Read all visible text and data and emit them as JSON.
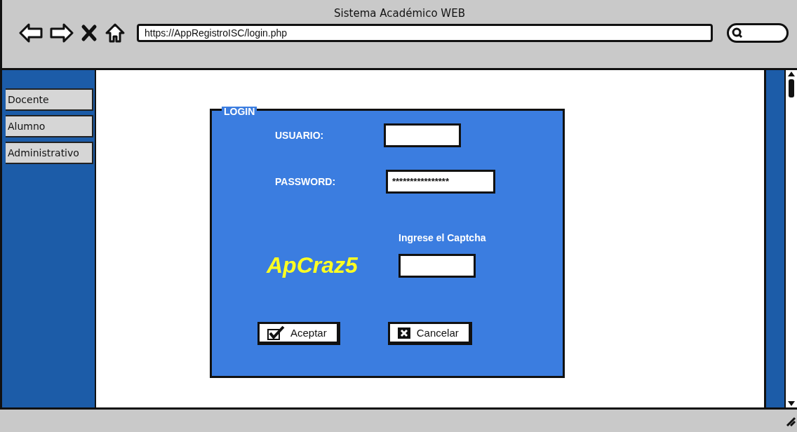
{
  "window": {
    "title": "Sistema Académico WEB"
  },
  "toolbar": {
    "url": "https://AppRegistroISC/login.php"
  },
  "sidebar": {
    "items": [
      {
        "label": "Docente"
      },
      {
        "label": "Alumno"
      },
      {
        "label": "Administrativo"
      }
    ]
  },
  "login": {
    "legend": "LOGIN",
    "fields": [
      {
        "label": "USUARIO:"
      },
      {
        "label": "PASSWORD:",
        "value": "****************"
      }
    ],
    "captcha": {
      "prompt": "Ingrese el Captcha",
      "code": "ApCraz5"
    },
    "buttons": [
      {
        "label": "Aceptar",
        "kind": "accept"
      },
      {
        "label": "Cancelar",
        "kind": "cancel"
      }
    ]
  }
}
